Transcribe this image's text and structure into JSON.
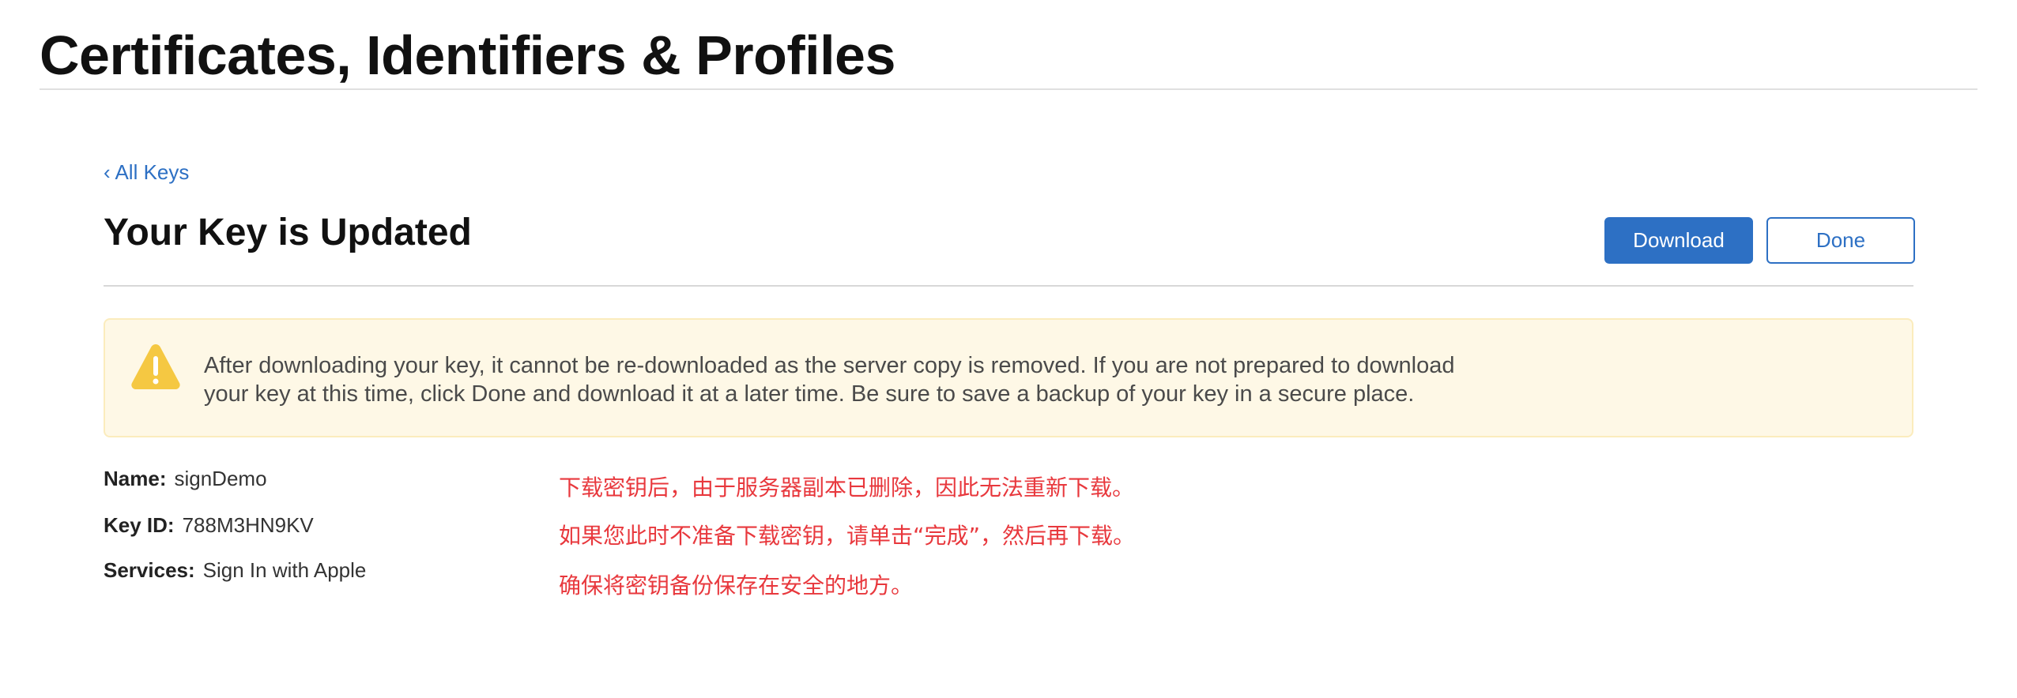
{
  "header": {
    "title": "Certificates, Identifiers & Profiles"
  },
  "breadcrumb": {
    "back_label": "‹ All Keys"
  },
  "section": {
    "title": "Your Key is Updated"
  },
  "actions": {
    "download_label": "Download",
    "done_label": "Done"
  },
  "warning": {
    "icon": "warning-triangle-icon",
    "line1": "After downloading your key, it cannot be re-downloaded as the server copy is removed. If you are not prepared to download",
    "line2": "your key at this time, click Done and download it at a later time. Be sure to save a backup of your key in a secure place."
  },
  "details": [
    {
      "label": "Name:",
      "value": "signDemo"
    },
    {
      "label": "Key ID:",
      "value": "788M3HN9KV"
    },
    {
      "label": "Services:",
      "value": "Sign In with Apple"
    }
  ],
  "annotations": [
    "下载密钥后，由于服务器副本已删除，因此无法重新下载。",
    "如果您此时不准备下载密钥，请单击“完成”，然后再下载。",
    "确保将密钥备份保存在安全的地方。"
  ],
  "colors": {
    "accent": "#2d70c4",
    "warning_bg": "#fef8e6",
    "warning_icon": "#f5c842",
    "annotation": "#e8383d"
  }
}
